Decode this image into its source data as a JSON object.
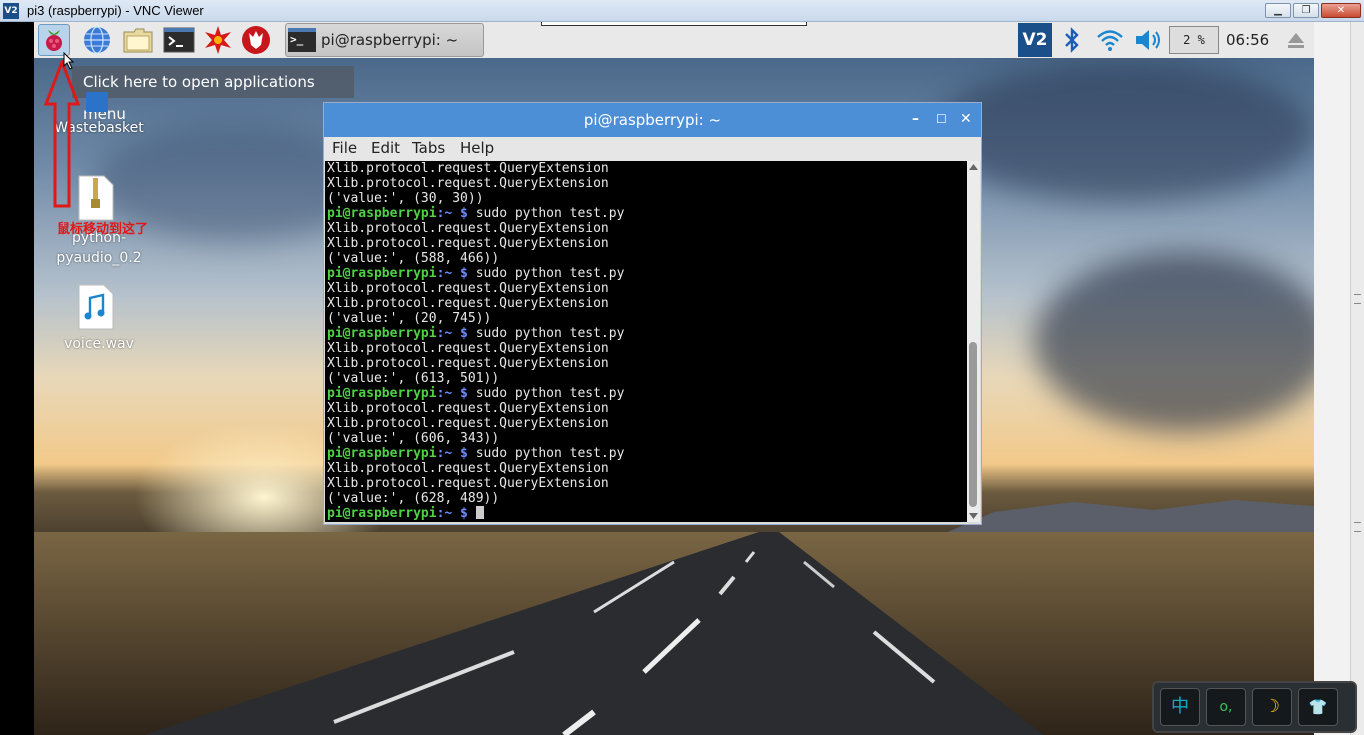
{
  "vnc": {
    "logo": "V2",
    "title": "pi3 (raspberrypi) - VNC Viewer",
    "minimize": "▁",
    "restore": "❐",
    "close": "✕"
  },
  "panel": {
    "menu_icon": "raspberry-icon",
    "launchers": [
      "globe-icon",
      "folder-icon",
      "terminal-icon",
      "mathematica-icon",
      "wolfram-icon"
    ],
    "task_label": "pi@raspberrypi: ~",
    "task_icon_text": ">_",
    "tray": {
      "vnc": "V2",
      "cpu": "2 %",
      "clock": "06:56"
    }
  },
  "tooltip": "Click here to open applications menu",
  "desktop_icons": [
    {
      "label": "Wastebasket"
    },
    {
      "label": "python-pyaudio_0.2"
    },
    {
      "label": "voice.wav"
    }
  ],
  "annotation": "鼠标移动到这了",
  "terminal": {
    "title": "pi@raspberrypi: ~",
    "menu": [
      "File",
      "Edit",
      "Tabs",
      "Help"
    ],
    "lines": [
      {
        "type": "out",
        "text": "Xlib.protocol.request.QueryExtension"
      },
      {
        "type": "out",
        "text": "Xlib.protocol.request.QueryExtension"
      },
      {
        "type": "out",
        "text": "('value:', (30, 30))"
      },
      {
        "type": "prompt",
        "cmd": " sudo python test.py"
      },
      {
        "type": "out",
        "text": "Xlib.protocol.request.QueryExtension"
      },
      {
        "type": "out",
        "text": "Xlib.protocol.request.QueryExtension"
      },
      {
        "type": "out",
        "text": "('value:', (588, 466))"
      },
      {
        "type": "prompt",
        "cmd": " sudo python test.py"
      },
      {
        "type": "out",
        "text": "Xlib.protocol.request.QueryExtension"
      },
      {
        "type": "out",
        "text": "Xlib.protocol.request.QueryExtension"
      },
      {
        "type": "out",
        "text": "('value:', (20, 745))"
      },
      {
        "type": "prompt",
        "cmd": " sudo python test.py"
      },
      {
        "type": "out",
        "text": "Xlib.protocol.request.QueryExtension"
      },
      {
        "type": "out",
        "text": "Xlib.protocol.request.QueryExtension"
      },
      {
        "type": "out",
        "text": "('value:', (613, 501))"
      },
      {
        "type": "prompt",
        "cmd": " sudo python test.py"
      },
      {
        "type": "out",
        "text": "Xlib.protocol.request.QueryExtension"
      },
      {
        "type": "out",
        "text": "Xlib.protocol.request.QueryExtension"
      },
      {
        "type": "out",
        "text": "('value:', (606, 343))"
      },
      {
        "type": "prompt",
        "cmd": " sudo python test.py"
      },
      {
        "type": "out",
        "text": "Xlib.protocol.request.QueryExtension"
      },
      {
        "type": "out",
        "text": "Xlib.protocol.request.QueryExtension"
      },
      {
        "type": "out",
        "text": "('value:', (628, 489))"
      },
      {
        "type": "prompt",
        "cmd": " ",
        "cursor": true
      }
    ],
    "prompt_user": "pi@raspberrypi",
    "prompt_path": ":~ $"
  },
  "ime": {
    "buttons": [
      "中",
      "o,",
      "☽",
      "👕"
    ]
  }
}
